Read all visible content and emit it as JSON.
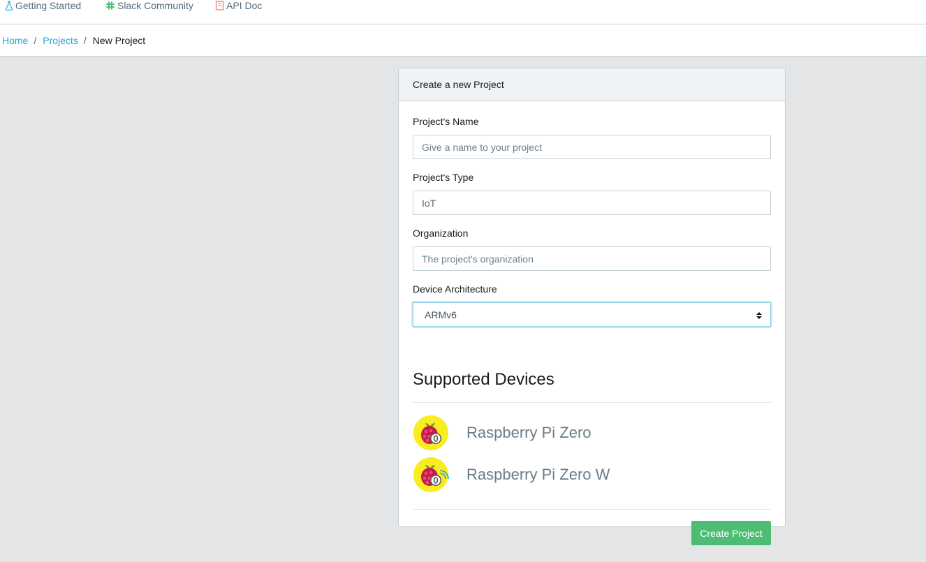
{
  "topnav": {
    "items": [
      {
        "label": "Getting Started",
        "icon": "flask-icon",
        "color": "#20a8d8"
      },
      {
        "label": "Slack Community",
        "icon": "slack-icon",
        "color": "#4dbd74"
      },
      {
        "label": "API Doc",
        "icon": "book-icon",
        "color": "#f86c6b"
      }
    ]
  },
  "breadcrumb": {
    "home": "Home",
    "projects": "Projects",
    "current": "New Project",
    "separator": "/"
  },
  "card": {
    "title": "Create a new Project",
    "fields": {
      "name": {
        "label": "Project's Name",
        "placeholder": "Give a name to your project",
        "value": ""
      },
      "type": {
        "label": "Project's Type",
        "value": "IoT"
      },
      "organization": {
        "label": "Organization",
        "placeholder": "The project's organization",
        "value": ""
      },
      "architecture": {
        "label": "Device Architecture",
        "value": "ARMv6"
      }
    },
    "supported_title": "Supported Devices",
    "devices": [
      {
        "name": "Raspberry Pi Zero",
        "icon": "raspberry-pi-zero-icon"
      },
      {
        "name": "Raspberry Pi Zero W",
        "icon": "raspberry-pi-zero-w-icon"
      }
    ],
    "submit_label": "Create Project"
  },
  "colors": {
    "link": "#20a8d8",
    "success": "#4dbd74",
    "border": "#c2cfd6",
    "page_bg": "#e4e5e6"
  }
}
